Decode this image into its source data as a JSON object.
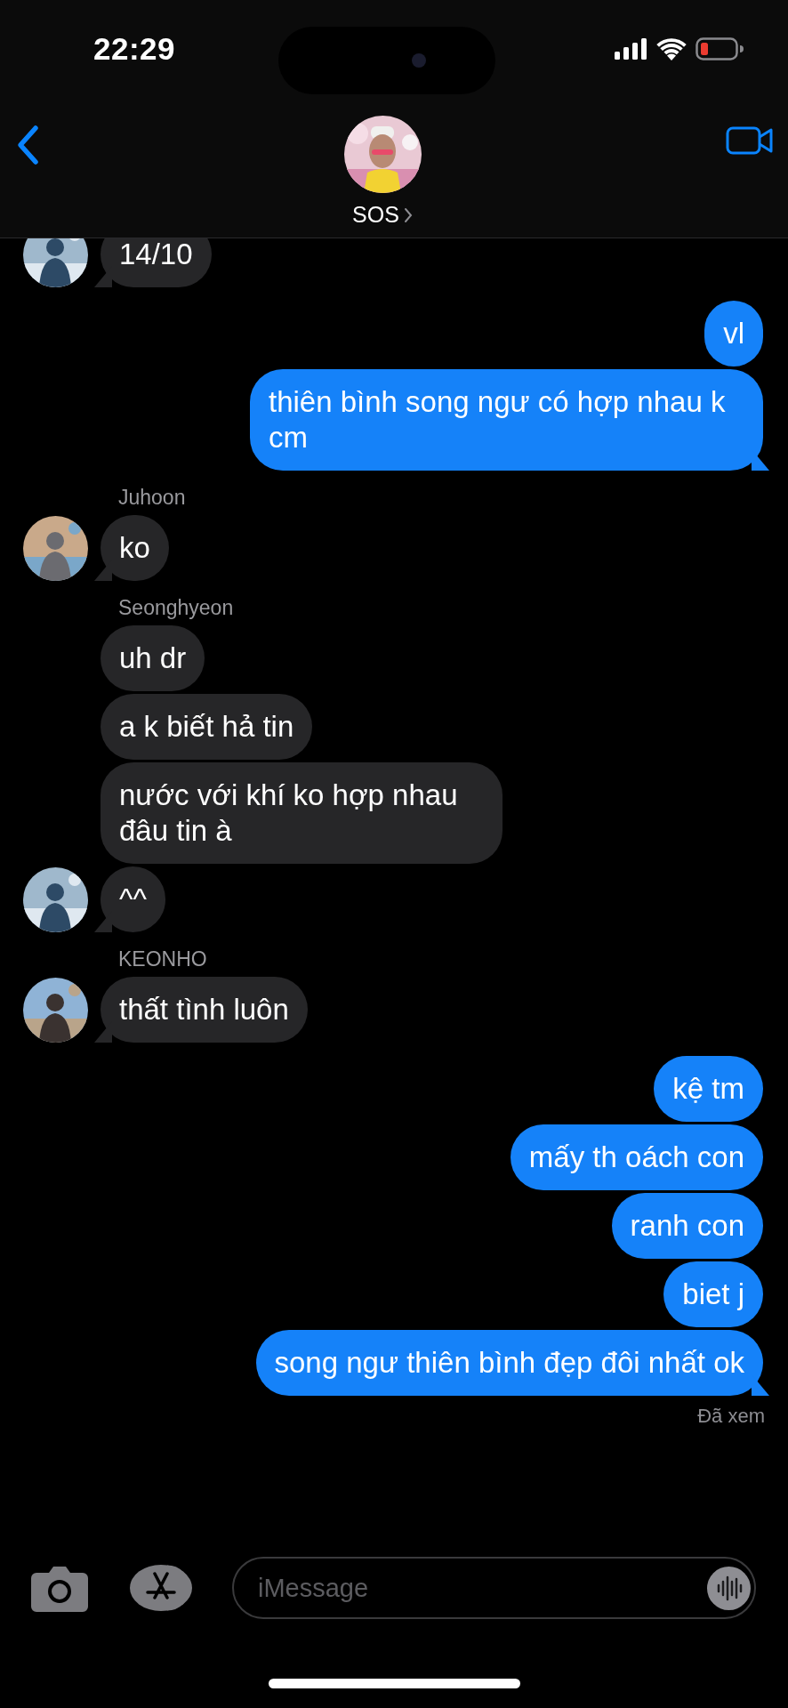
{
  "status_bar": {
    "time": "22:29"
  },
  "header": {
    "contact_name": "SOS"
  },
  "thread": [
    {
      "kind": "incoming",
      "text": "14/10",
      "tail": true
    },
    {
      "kind": "outgoing",
      "text": "vl",
      "tail": false
    },
    {
      "kind": "outgoing",
      "text": "thiên bình song ngư có hợp nhau k cm",
      "tail": true
    },
    {
      "kind": "sender",
      "text": "Juhoon"
    },
    {
      "kind": "incoming",
      "text": "ko",
      "tail": true
    },
    {
      "kind": "sender",
      "text": "Seonghyeon"
    },
    {
      "kind": "incoming",
      "text": "uh dr",
      "tail": false
    },
    {
      "kind": "incoming",
      "text": "a k biết hả tin",
      "tail": false
    },
    {
      "kind": "incoming",
      "text": "nước với khí ko hợp nhau đâu tin à",
      "tail": false
    },
    {
      "kind": "incoming",
      "text": "^^",
      "tail": true
    },
    {
      "kind": "sender",
      "text": "KEONHO"
    },
    {
      "kind": "incoming",
      "text": "thất tình luôn",
      "tail": true
    },
    {
      "kind": "outgoing",
      "text": "kệ tm",
      "tail": false
    },
    {
      "kind": "outgoing",
      "text": "mấy th oách con",
      "tail": false
    },
    {
      "kind": "outgoing",
      "text": "ranh con",
      "tail": false
    },
    {
      "kind": "outgoing",
      "text": "biet j",
      "tail": false
    },
    {
      "kind": "outgoing",
      "text": "song ngư thiên bình đẹp đôi nhất ok",
      "tail": true
    },
    {
      "kind": "receipt",
      "text": "Đã xem"
    }
  ],
  "composer": {
    "placeholder": "iMessage"
  }
}
